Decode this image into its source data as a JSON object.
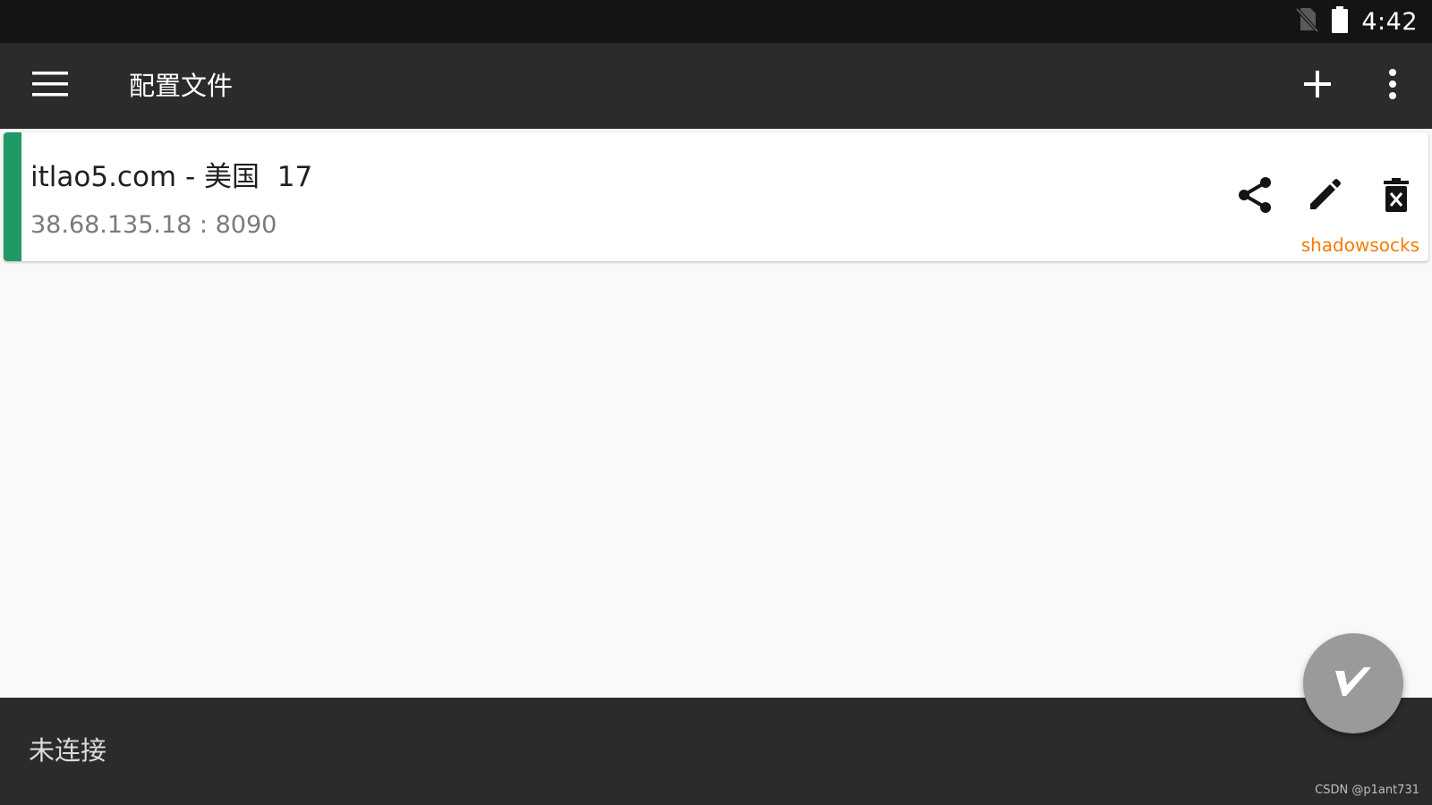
{
  "status_bar": {
    "time": "4:42",
    "icons": [
      "no-sim-icon",
      "battery-icon"
    ]
  },
  "toolbar": {
    "title": "配置文件",
    "menu_icon": "hamburger-menu-icon",
    "add_icon": "plus-icon",
    "more_icon": "more-vertical-icon"
  },
  "servers": [
    {
      "name": "itlao5.com - 美国  17",
      "address": "38.68.135.18 : 8090",
      "type": "shadowsocks",
      "selected": true,
      "actions": [
        "share-icon",
        "edit-icon",
        "delete-icon"
      ]
    }
  ],
  "bottom_bar": {
    "status": "未连接",
    "watermark": "CSDN @p1ant731"
  },
  "fab": {
    "icon": "v2ray-logo-icon"
  },
  "colors": {
    "toolbar_bg": "#2b2b2b",
    "status_bar_bg": "#141414",
    "selected_indicator": "#1f9a66",
    "type_label": "#f57c00",
    "fab_bg": "#9a9a9a",
    "content_bg": "#f9f9f9"
  }
}
